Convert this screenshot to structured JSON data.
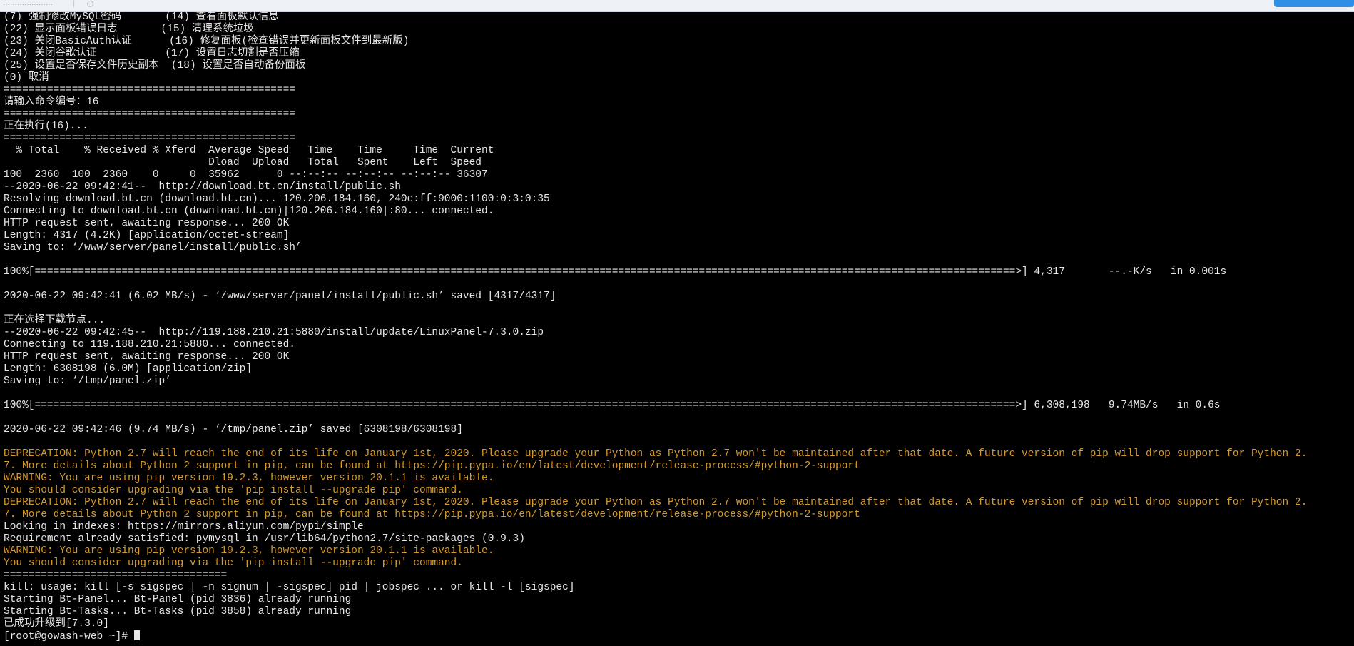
{
  "browser": {
    "tab_title": "…………………",
    "separator": "|"
  },
  "terminal": {
    "colors": {
      "background": "#000000",
      "text": "#e6e6e6",
      "warning": "#d49a2c"
    },
    "lines": [
      {
        "text": "(7) 强制修改MySQL密码       (14) 查看面板默认信息",
        "style": "normal"
      },
      {
        "text": "(22) 显示面板错误日志       (15) 清理系统垃圾",
        "style": "normal"
      },
      {
        "text": "(23) 关闭BasicAuth认证      (16) 修复面板(检查错误并更新面板文件到最新版)",
        "style": "normal"
      },
      {
        "text": "(24) 关闭谷歌认证           (17) 设置日志切割是否压缩",
        "style": "normal"
      },
      {
        "text": "(25) 设置是否保存文件历史副本  (18) 设置是否自动备份面板",
        "style": "normal"
      },
      {
        "text": "(0) 取消",
        "style": "normal"
      },
      {
        "text": "===============================================",
        "style": "normal"
      },
      {
        "text": "请输入命令编号：16",
        "style": "normal"
      },
      {
        "text": "===============================================",
        "style": "normal"
      },
      {
        "text": "正在执行(16)...",
        "style": "normal"
      },
      {
        "text": "===============================================",
        "style": "normal"
      },
      {
        "text": "  % Total    % Received % Xferd  Average Speed   Time    Time     Time  Current",
        "style": "normal"
      },
      {
        "text": "                                 Dload  Upload   Total   Spent    Left  Speed",
        "style": "normal"
      },
      {
        "text": "100  2360  100  2360    0     0  35962      0 --:--:-- --:--:-- --:--:-- 36307",
        "style": "normal"
      },
      {
        "text": "--2020-06-22 09:42:41--  http://download.bt.cn/install/public.sh",
        "style": "normal"
      },
      {
        "text": "Resolving download.bt.cn (download.bt.cn)... 120.206.184.160, 240e:ff:9000:1100:0:3:0:35",
        "style": "normal"
      },
      {
        "text": "Connecting to download.bt.cn (download.bt.cn)|120.206.184.160|:80... connected.",
        "style": "normal"
      },
      {
        "text": "HTTP request sent, awaiting response... 200 OK",
        "style": "normal"
      },
      {
        "text": "Length: 4317 (4.2K) [application/octet-stream]",
        "style": "normal"
      },
      {
        "text": "Saving to: ‘/www/server/panel/install/public.sh’",
        "style": "normal"
      },
      {
        "text": "",
        "style": "normal"
      },
      {
        "text": "100%[==============================================================================================================================================================>] 4,317       --.-K/s   in 0.001s",
        "style": "normal"
      },
      {
        "text": "",
        "style": "normal"
      },
      {
        "text": "2020-06-22 09:42:41 (6.02 MB/s) - ‘/www/server/panel/install/public.sh’ saved [4317/4317]",
        "style": "normal"
      },
      {
        "text": "",
        "style": "normal"
      },
      {
        "text": "正在选择下载节点...",
        "style": "normal"
      },
      {
        "text": "--2020-06-22 09:42:45--  http://119.188.210.21:5880/install/update/LinuxPanel-7.3.0.zip",
        "style": "normal"
      },
      {
        "text": "Connecting to 119.188.210.21:5880... connected.",
        "style": "normal"
      },
      {
        "text": "HTTP request sent, awaiting response... 200 OK",
        "style": "normal"
      },
      {
        "text": "Length: 6308198 (6.0M) [application/zip]",
        "style": "normal"
      },
      {
        "text": "Saving to: ‘/tmp/panel.zip’",
        "style": "normal"
      },
      {
        "text": "",
        "style": "normal"
      },
      {
        "text": "100%[==============================================================================================================================================================>] 6,308,198   9.74MB/s   in 0.6s",
        "style": "normal"
      },
      {
        "text": "",
        "style": "normal"
      },
      {
        "text": "2020-06-22 09:42:46 (9.74 MB/s) - ‘/tmp/panel.zip’ saved [6308198/6308198]",
        "style": "normal"
      },
      {
        "text": "",
        "style": "normal"
      },
      {
        "text": "DEPRECATION: Python 2.7 will reach the end of its life on January 1st, 2020. Please upgrade your Python as Python 2.7 won't be maintained after that date. A future version of pip will drop support for Python 2.",
        "style": "warn"
      },
      {
        "text": "7. More details about Python 2 support in pip, can be found at https://pip.pypa.io/en/latest/development/release-process/#python-2-support",
        "style": "warn"
      },
      {
        "text": "WARNING: You are using pip version 19.2.3, however version 20.1.1 is available.",
        "style": "warn"
      },
      {
        "text": "You should consider upgrading via the 'pip install --upgrade pip' command.",
        "style": "warn"
      },
      {
        "text": "DEPRECATION: Python 2.7 will reach the end of its life on January 1st, 2020. Please upgrade your Python as Python 2.7 won't be maintained after that date. A future version of pip will drop support for Python 2.",
        "style": "warn"
      },
      {
        "text": "7. More details about Python 2 support in pip, can be found at https://pip.pypa.io/en/latest/development/release-process/#python-2-support",
        "style": "warn"
      },
      {
        "text": "Looking in indexes: https://mirrors.aliyun.com/pypi/simple",
        "style": "normal"
      },
      {
        "text": "Requirement already satisfied: pymysql in /usr/lib64/python2.7/site-packages (0.9.3)",
        "style": "normal"
      },
      {
        "text": "WARNING: You are using pip version 19.2.3, however version 20.1.1 is available.",
        "style": "warn"
      },
      {
        "text": "You should consider upgrading via the 'pip install --upgrade pip' command.",
        "style": "warn"
      },
      {
        "text": "====================================",
        "style": "normal"
      },
      {
        "text": "kill: usage: kill [-s sigspec | -n signum | -sigspec] pid | jobspec ... or kill -l [sigspec]",
        "style": "normal"
      },
      {
        "text": "Starting Bt-Panel... Bt-Panel (pid 3836) already running",
        "style": "normal"
      },
      {
        "text": "Starting Bt-Tasks... Bt-Tasks (pid 3858) already running",
        "style": "normal"
      },
      {
        "text": "已成功升级到[7.3.0]",
        "style": "normal"
      }
    ],
    "prompt": "[root@gowash-web ~]# "
  }
}
